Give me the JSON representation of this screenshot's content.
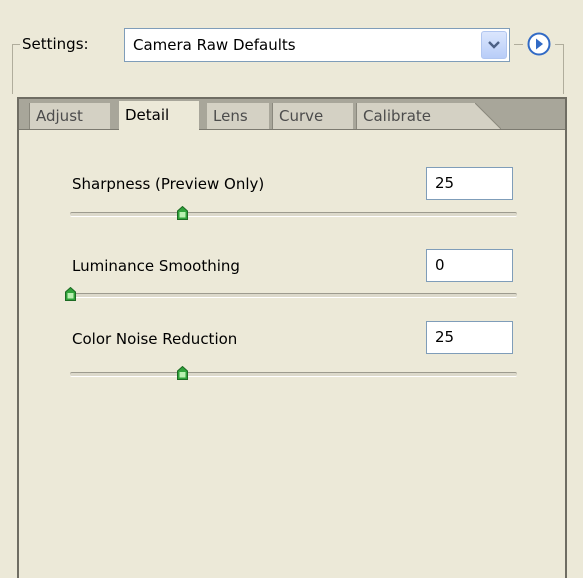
{
  "settings": {
    "label": "Settings:",
    "selected": "Camera Raw Defaults",
    "dropdown_icon": "chevron-down-icon",
    "menu_icon": "play-circle-icon"
  },
  "tabs": [
    {
      "label": "Adjust",
      "active": false
    },
    {
      "label": "Detail",
      "active": true
    },
    {
      "label": "Lens",
      "active": false
    },
    {
      "label": "Curve",
      "active": false
    },
    {
      "label": "Calibrate",
      "active": false
    }
  ],
  "detail": {
    "sharpness": {
      "label": "Sharpness  (Preview Only)",
      "value": "25",
      "level": 25
    },
    "luminance": {
      "label": "Luminance Smoothing",
      "value": "0",
      "level": 0
    },
    "color_noise": {
      "label": "Color Noise Reduction",
      "value": "25",
      "level": 25
    }
  },
  "colors": {
    "accent": "#316ac5",
    "thumb_green": "#2fa23a"
  }
}
